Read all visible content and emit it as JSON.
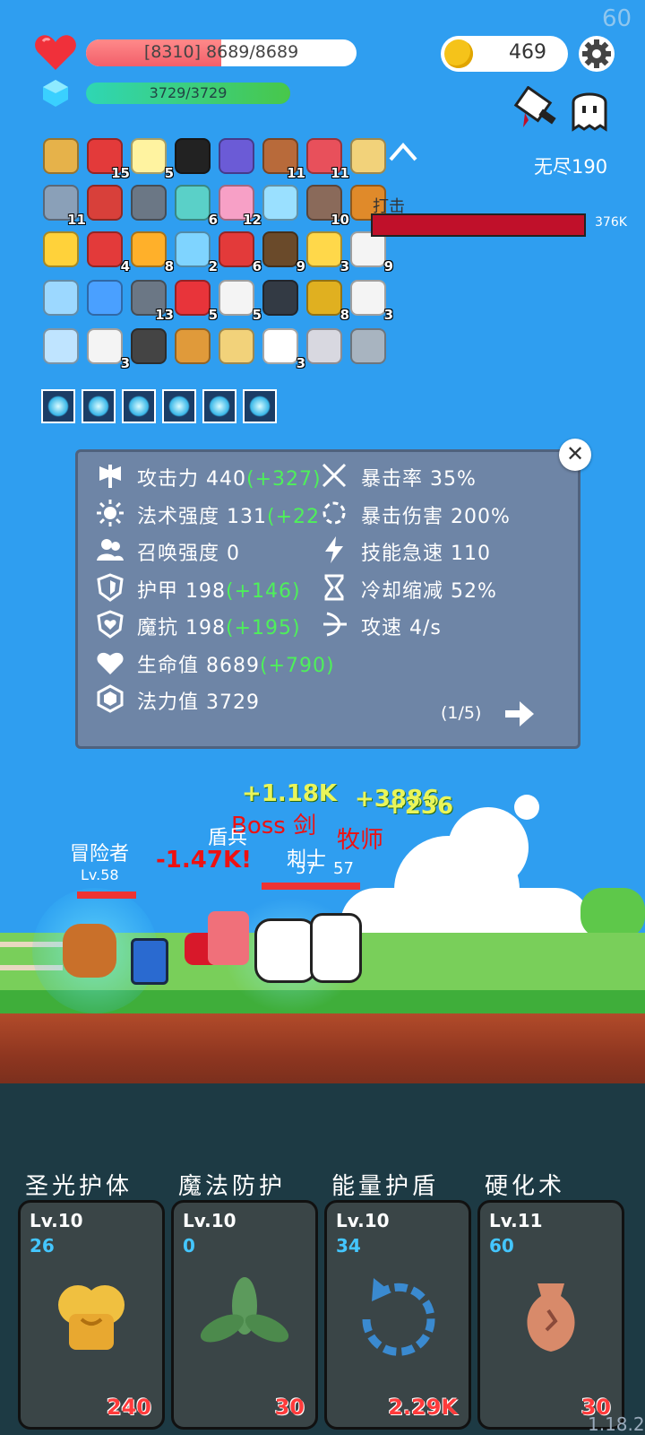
{
  "fps": "60",
  "hud": {
    "hp_text": "[8310] 8689/8689",
    "hp_ratio": 0.5,
    "mp_text": "3729/3729",
    "mp_ratio": 1.0,
    "coins": "469",
    "endless_label": "无尽190"
  },
  "items": [
    {
      "name": "scroll-icon",
      "count": "",
      "color": "#e6b24a"
    },
    {
      "name": "apple-icon",
      "count": "15",
      "color": "#e33a3a"
    },
    {
      "name": "flower-icon",
      "count": "5",
      "color": "#fff3a0"
    },
    {
      "name": "cauldron-icon",
      "count": "",
      "color": "#222"
    },
    {
      "name": "wizard-hat-icon",
      "count": "",
      "color": "#6b5bd6"
    },
    {
      "name": "donut-icon",
      "count": "11",
      "color": "#b86a3a"
    },
    {
      "name": "watermelon-icon",
      "count": "11",
      "color": "#e8505b"
    },
    {
      "name": "treasure-map-icon",
      "count": "",
      "color": "#f2d27a"
    },
    {
      "name": "sword-icon",
      "count": "11",
      "color": "#8aa0b8"
    },
    {
      "name": "magnet-icon",
      "count": "",
      "color": "#d8403a"
    },
    {
      "name": "spike-ball-icon",
      "count": "",
      "color": "#6b7785"
    },
    {
      "name": "wand-icon",
      "count": "6",
      "color": "#5ad0c8"
    },
    {
      "name": "ice-cream-icon",
      "count": "12",
      "color": "#f7a0c6"
    },
    {
      "name": "snowflake-icon",
      "count": "",
      "color": "#9ae0ff"
    },
    {
      "name": "tombstone-icon",
      "count": "10",
      "color": "#8a6a5a"
    },
    {
      "name": "book-icon",
      "count": "7",
      "color": "#e08a2a"
    },
    {
      "name": "sun-orb-icon",
      "count": "",
      "color": "#ffd23a"
    },
    {
      "name": "sock-icon",
      "count": "4",
      "color": "#e33a3a"
    },
    {
      "name": "battery-icon",
      "count": "8",
      "color": "#ffb02a"
    },
    {
      "name": "potion-icon",
      "count": "2",
      "color": "#7fd4ff"
    },
    {
      "name": "bookmark-icon",
      "count": "6",
      "color": "#e33a3a"
    },
    {
      "name": "coconut-icon",
      "count": "9",
      "color": "#6a4a2a"
    },
    {
      "name": "cheese-icon",
      "count": "3",
      "color": "#ffd84a"
    },
    {
      "name": "envelope-icon",
      "count": "9",
      "color": "#f4f4f4"
    },
    {
      "name": "robe-icon",
      "count": "",
      "color": "#9cd8ff"
    },
    {
      "name": "id-card-icon",
      "count": "",
      "color": "#4aa0ff"
    },
    {
      "name": "mace-icon",
      "count": "13",
      "color": "#6b7785"
    },
    {
      "name": "strawberry-icon",
      "count": "5",
      "color": "#e8343a"
    },
    {
      "name": "cards-icon",
      "count": "5",
      "color": "#f4f4f4"
    },
    {
      "name": "skull-book-icon",
      "count": "",
      "color": "#333a44"
    },
    {
      "name": "durian-icon",
      "count": "8",
      "color": "#e0b020"
    },
    {
      "name": "pill-icon",
      "count": "3",
      "color": "#f4f4f4"
    },
    {
      "name": "frame-icon",
      "count": "",
      "color": "#bfe4ff"
    },
    {
      "name": "dice-icon",
      "count": "3",
      "color": "#f4f4f4"
    },
    {
      "name": "glove-icon",
      "count": "",
      "color": "#444"
    },
    {
      "name": "bow-icon",
      "count": "",
      "color": "#e09a3a"
    },
    {
      "name": "quill-paper-icon",
      "count": "",
      "color": "#f2d27a"
    },
    {
      "name": "ghost-icon",
      "count": "3",
      "color": "#ffffff"
    },
    {
      "name": "hook-icon",
      "count": "",
      "color": "#d8d8e0"
    },
    {
      "name": "axe-icon",
      "count": "",
      "color": "#a8b4c0"
    }
  ],
  "equipped_skills": [
    "light-skill-icon",
    "swirl-skill-icon",
    "swirl-skill-icon",
    "swirl-skill-icon",
    "grid-skill-icon",
    "bar-skill-icon"
  ],
  "boss": {
    "label": "打击",
    "hp": "376K"
  },
  "stats": {
    "left": [
      {
        "icon": "attack-icon",
        "label": "攻击力",
        "value": "440",
        "bonus": "(+327)"
      },
      {
        "icon": "sun-icon",
        "label": "法术强度",
        "value": "131",
        "bonus": "(+22"
      },
      {
        "icon": "summon-icon",
        "label": "召唤强度",
        "value": "0",
        "bonus": ""
      },
      {
        "icon": "armor-icon",
        "label": "护甲",
        "value": "198",
        "bonus": "(+146)"
      },
      {
        "icon": "magic-resist-icon",
        "label": "魔抗",
        "value": "198",
        "bonus": "(+195)"
      },
      {
        "icon": "heart-icon",
        "label": "生命值",
        "value": "8689",
        "bonus": "(+790)"
      },
      {
        "icon": "mana-gem-icon",
        "label": "法力值",
        "value": "3729",
        "bonus": ""
      }
    ],
    "right": [
      {
        "icon": "crit-rate-icon",
        "label": "暴击率",
        "value": "35%"
      },
      {
        "icon": "crit-damage-icon",
        "label": "暴击伤害",
        "value": "200%"
      },
      {
        "icon": "lightning-icon",
        "label": "技能急速",
        "value": "110"
      },
      {
        "icon": "hourglass-icon",
        "label": "冷却缩减",
        "value": "52%"
      },
      {
        "icon": "bow-speed-icon",
        "label": "攻速",
        "value": "4/s"
      }
    ],
    "page": "(1/5)"
  },
  "battle": {
    "hero_name": "冒险者",
    "hero_level": "Lv.58",
    "floating": [
      "+1.18K",
      "+3886",
      "+236",
      "-1.47K!",
      "Boss 剑",
      "盾兵",
      "牧师",
      "刺士",
      "57",
      "57"
    ]
  },
  "skills": [
    {
      "name": "圣光护体",
      "level": "Lv.10",
      "count": "26",
      "cost": "240",
      "art": "holy-shield-art"
    },
    {
      "name": "魔法防护",
      "level": "Lv.10",
      "count": "0",
      "cost": "30",
      "art": "leaf-art"
    },
    {
      "name": "能量护盾",
      "level": "Lv.10",
      "count": "34",
      "cost": "2.29K",
      "art": "refresh-art"
    },
    {
      "name": "硬化术",
      "level": "Lv.11",
      "count": "60",
      "cost": "30",
      "art": "vase-art"
    }
  ],
  "version": "1.18.2",
  "colors": {
    "sky": "#2f9ef0",
    "panel": "#6e85a6",
    "bonus": "#4ef05a",
    "cost": "#ff3b3b",
    "level_count": "#44c6ff"
  }
}
